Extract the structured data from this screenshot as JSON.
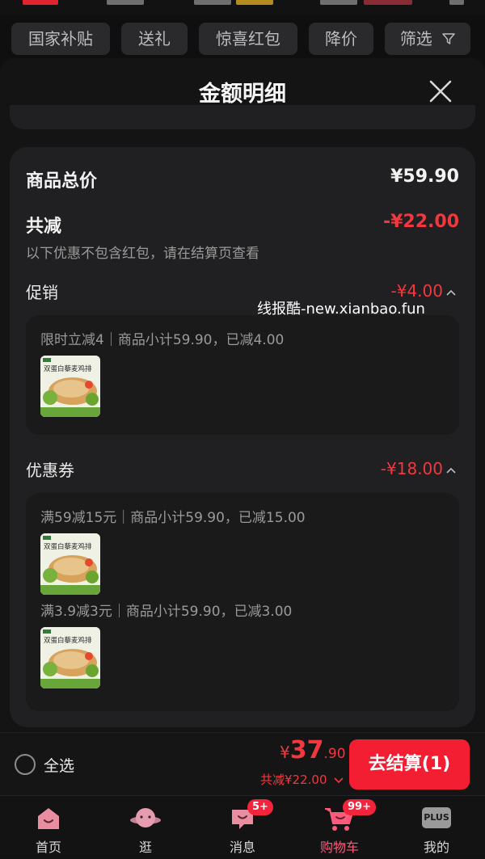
{
  "filters": {
    "chips": [
      {
        "label": "国家补贴"
      },
      {
        "label": "送礼"
      },
      {
        "label": "惊喜红包"
      },
      {
        "label": "降价"
      },
      {
        "label": "筛选"
      }
    ]
  },
  "sheet": {
    "title": "金额明细"
  },
  "summary": {
    "total_label": "商品总价",
    "total_value": "¥59.90",
    "discount_label": "共减",
    "discount_value": "-¥22.00",
    "note": "以下优惠不包含红包，请在结算页查看"
  },
  "promotion": {
    "label": "促销",
    "value": "-¥4.00",
    "items": [
      {
        "text": "限时立减4｜商品小计59.90，已减4.00"
      }
    ]
  },
  "coupons": {
    "label": "优惠券",
    "value": "-¥18.00",
    "items": [
      {
        "text": "满59减15元｜商品小计59.90，已减15.00"
      },
      {
        "text": "满3.9减3元｜商品小计59.90，已减3.00"
      }
    ]
  },
  "product": {
    "thumb_text": "双蛋白藜麦鸡排"
  },
  "watermark": "线报酷-new.xianbao.fun",
  "checkout": {
    "select_all_label": "全选",
    "currency": "¥",
    "price_int": "37",
    "price_dec": ".90",
    "saved_text": "共减¥22.00",
    "button_label": "去结算(1)"
  },
  "tabbar": {
    "items": [
      {
        "label": "首页"
      },
      {
        "label": "逛"
      },
      {
        "label": "消息",
        "badge": "5+"
      },
      {
        "label": "购物车",
        "badge": "99+"
      },
      {
        "label": "我的",
        "icon_text": "PLUS"
      }
    ]
  },
  "colors": {
    "accent_red": "#f41e33",
    "discount_red": "#f2383e",
    "active_tab": "#ff5a7a"
  }
}
